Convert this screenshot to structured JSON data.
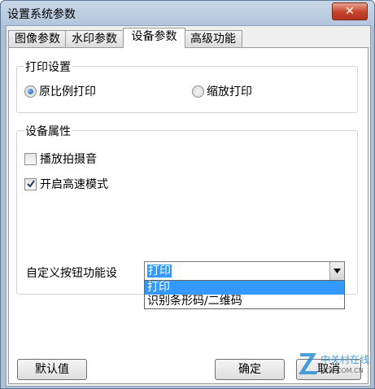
{
  "window": {
    "title": "设置系统参数",
    "close": "✕"
  },
  "tabs": [
    {
      "label": "图像参数"
    },
    {
      "label": "水印参数"
    },
    {
      "label": "设备参数",
      "active": true
    },
    {
      "label": "高级功能"
    }
  ],
  "print_settings": {
    "group_title": "打印设置",
    "options": [
      {
        "label": "原比例打印",
        "selected": true
      },
      {
        "label": "缩放打印",
        "selected": false
      }
    ]
  },
  "device_properties": {
    "group_title": "设备属性",
    "checkboxes": [
      {
        "label": "播放拍摄音",
        "checked": false
      },
      {
        "label": "开启高速模式",
        "checked": true
      }
    ],
    "custom_button": {
      "label": "自定义按钮功能设",
      "value": "打印",
      "options": [
        "打印",
        "识别条形码/二维码"
      ]
    }
  },
  "buttons": {
    "default": "默认值",
    "ok": "确定",
    "cancel": "取消"
  },
  "watermark": {
    "text": "中关村在线",
    "sub": "ZOL.COM.CN",
    "accent": "#2a8fd6"
  }
}
